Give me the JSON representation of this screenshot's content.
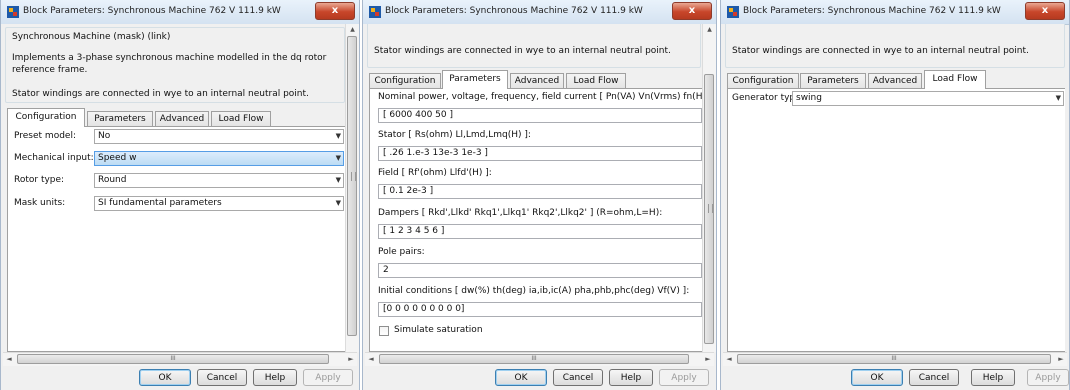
{
  "dialog_title": "Block Parameters: Synchronous Machine 762 V 111.9 kW",
  "close_glyph": "x",
  "buttons": {
    "ok": "OK",
    "cancel": "Cancel",
    "help": "Help",
    "apply": "Apply"
  },
  "scroll_glyphs": {
    "up": "▲",
    "down": "▼",
    "left": "◄",
    "right": "►",
    "grip": "III"
  },
  "tab_labels": [
    "Configuration",
    "Parameters",
    "Advanced",
    "Load Flow"
  ],
  "stator_note": "Stator windings are connected in wye to an internal neutral point.",
  "window1": {
    "group_title": "Synchronous Machine (mask) (link)",
    "description": "Implements a 3-phase synchronous machine modelled in the dq rotor reference frame.",
    "active_tab": "Configuration",
    "fields": [
      {
        "label": "Preset  model:",
        "value": "No"
      },
      {
        "label": "Mechanical input:",
        "value": "Speed w"
      },
      {
        "label": "Rotor type:",
        "value": "Round"
      },
      {
        "label": "Mask units:",
        "value": "SI fundamental parameters"
      }
    ]
  },
  "window2": {
    "active_tab": "Parameters",
    "fields": [
      {
        "label": "Nominal power, voltage, frequency, field current  [ Pn(VA) Vn(Vrms) fn(Hz) ifn(A) ]:",
        "value": "[ 6000 400  50 ]"
      },
      {
        "label": "Stator  [ Rs(ohm)  Ll,Lmd,Lmq(H) ]:",
        "value": "[ .26 1.e-3 13e-3 1e-3 ]"
      },
      {
        "label": "Field  [ Rf'(ohm)  Llfd'(H) ]:",
        "value": "[ 0.1 2e-3 ]"
      },
      {
        "label": "Dampers  [ Rkd',Llkd'  Rkq1',Llkq1'  Rkq2',Llkq2'  ] (R=ohm,L=H):",
        "value": "[ 1 2 3 4 5 6 ]"
      },
      {
        "label": "Pole pairs:",
        "value": "2"
      },
      {
        "label": "Initial conditions  [ dw(%)  th(deg)  ia,ib,ic(A)  pha,phb,phc(deg)  Vf(V) ]:",
        "value": "[0 0 0 0 0 0 0 0 0]"
      }
    ],
    "checkbox_label": "Simulate saturation"
  },
  "window3": {
    "active_tab": "Load Flow",
    "generator_label": "Generator type",
    "generator_value": "swing"
  }
}
